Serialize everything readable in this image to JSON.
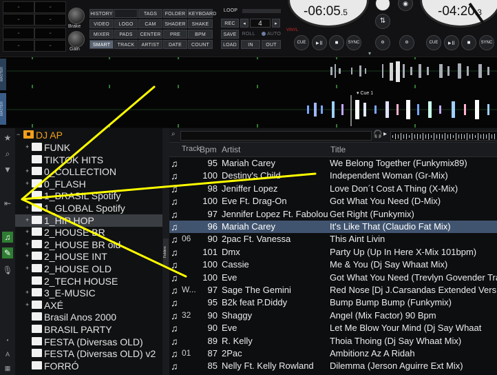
{
  "top": {
    "counters": [
      "-",
      "-",
      "-",
      "-",
      "-",
      "-",
      "-",
      "-"
    ],
    "knobs": {
      "brake": "Brake",
      "gain": "Gain"
    },
    "browser_buttons": [
      [
        "HISTORY",
        "",
        "TAGS",
        "FOLDER",
        "KEYBOARD"
      ],
      [
        "VIDEO",
        "LOGO",
        "CAM",
        "SHADER",
        "SHAKE"
      ],
      [
        "MIXER",
        "PADS",
        "CENTER",
        "PRE",
        "BPM"
      ],
      [
        "SMART",
        "TRACK",
        "ARTIST",
        "DATE",
        "COUNT"
      ]
    ],
    "loop": {
      "title": "LOOP",
      "rec": "REC",
      "value": "4",
      "save": "SAVE",
      "roll": "ROLL",
      "auto": "AUTO",
      "load": "LOAD",
      "in": "IN",
      "out": "OUT"
    },
    "deck_left": {
      "time": "-06:05",
      "time_frac": ".5",
      "vinyl": "VINYL",
      "cue": "CUE",
      "sync": "SYNC"
    },
    "deck_right": {
      "time": "-04:20",
      "time_frac": ".3",
      "cue": "CUE",
      "sync": "SYNC"
    }
  },
  "waveform": {
    "label_top": "MASTER",
    "label_bottom": "MASTER",
    "cue_label": "Cue 1"
  },
  "tree": {
    "root": "DJ AP",
    "items": [
      {
        "label": "FUNK",
        "expand": true
      },
      {
        "label": "TIKTOK HITS",
        "expand": false
      },
      {
        "label": "0_COLLECTION",
        "expand": true
      },
      {
        "label": "0_FLASH",
        "expand": true
      },
      {
        "label": "1_BRASIL Spotify",
        "expand": true
      },
      {
        "label": "1_GLOBAL Spotify",
        "expand": true
      },
      {
        "label": "1_HIP HOP",
        "expand": true
      },
      {
        "label": "2_HOUSE BR",
        "expand": true
      },
      {
        "label": "2_HOUSE BR old",
        "expand": true
      },
      {
        "label": "2_HOUSE INT",
        "expand": true
      },
      {
        "label": "2_HOUSE OLD",
        "expand": true
      },
      {
        "label": "2_TECH HOUSE",
        "expand": false
      },
      {
        "label": "3_E-MUSIC",
        "expand": true
      },
      {
        "label": "AXÉ",
        "expand": true
      },
      {
        "label": "Brasil Anos 2000",
        "expand": false
      },
      {
        "label": "BRASIL PARTY",
        "expand": false
      },
      {
        "label": "FESTA (Diversas OLD)",
        "expand": false
      },
      {
        "label": "FESTA (Diversas OLD) v2",
        "expand": false
      },
      {
        "label": "FORRÓ",
        "expand": false
      }
    ]
  },
  "sidestrip_label": "Folders",
  "list": {
    "headers": {
      "track": "Track",
      "bpm": "Bpm",
      "artist": "Artist",
      "title": "Title"
    },
    "rows": [
      {
        "track": "",
        "bpm": "95",
        "artist": "Mariah Carey",
        "title": "We Belong Together (Funkymix89)"
      },
      {
        "track": "",
        "bpm": "100",
        "artist": "Destiny's Child",
        "title": "Independent Woman (Gr-Mix)"
      },
      {
        "track": "",
        "bpm": "98",
        "artist": "Jeniffer Lopez",
        "title": "Love Don´t Cost A Thing (X-Mix)"
      },
      {
        "track": "",
        "bpm": "100",
        "artist": "Eve Ft. Drag-On",
        "title": "Got What You Need (D-Mix)"
      },
      {
        "track": "",
        "bpm": "97",
        "artist": "Jennifer Lopez Ft. Fabolous",
        "title": "Get Right (Funkymix)"
      },
      {
        "track": "",
        "bpm": "96",
        "artist": "Mariah Carey",
        "title": "It's Like That (Claudio Fat Mix)"
      },
      {
        "track": "06",
        "bpm": "90",
        "artist": "2pac Ft. Vanessa",
        "title": "This Aint Livin"
      },
      {
        "track": "",
        "bpm": "101",
        "artist": "Dmx",
        "title": "Party Up (Up In Here X-Mix 101bpm)"
      },
      {
        "track": "",
        "bpm": "100",
        "artist": "Cassie",
        "title": "Me & You (Dj Say Whaat Mix)"
      },
      {
        "track": "",
        "bpm": "100",
        "artist": "Eve",
        "title": "Got What You Need (Trevlyn Govender Trans"
      },
      {
        "track": "W...",
        "bpm": "97",
        "artist": "Sage The Gemini",
        "title": "Red Nose [Dj J.Carsandas Extended Vers"
      },
      {
        "track": "",
        "bpm": "95",
        "artist": "B2k feat P.Diddy",
        "title": "Bump Bump Bump (Funkymix)"
      },
      {
        "track": "32",
        "bpm": "90",
        "artist": "Shaggy",
        "title": "Angel (Mix Factor) 90 Bpm"
      },
      {
        "track": "",
        "bpm": "90",
        "artist": "Eve",
        "title": "Let Me Blow Your Mind (Dj Say Whaat"
      },
      {
        "track": "",
        "bpm": "89",
        "artist": "R. Kelly",
        "title": "Thoia Thoing (Dj Say Whaat Mix)"
      },
      {
        "track": "01",
        "bpm": "87",
        "artist": "2Pac",
        "title": "Ambitionz Az A Ridah"
      },
      {
        "track": "",
        "bpm": "85",
        "artist": "Nelly Ft. Kelly Rowland",
        "title": "Dilemma (Jerson Aguirre Ext Mix)"
      }
    ],
    "selected_index": 5
  },
  "colors": {
    "accent": "#f3a01b",
    "selection": "#41546f",
    "annotation": "#ffff00"
  }
}
